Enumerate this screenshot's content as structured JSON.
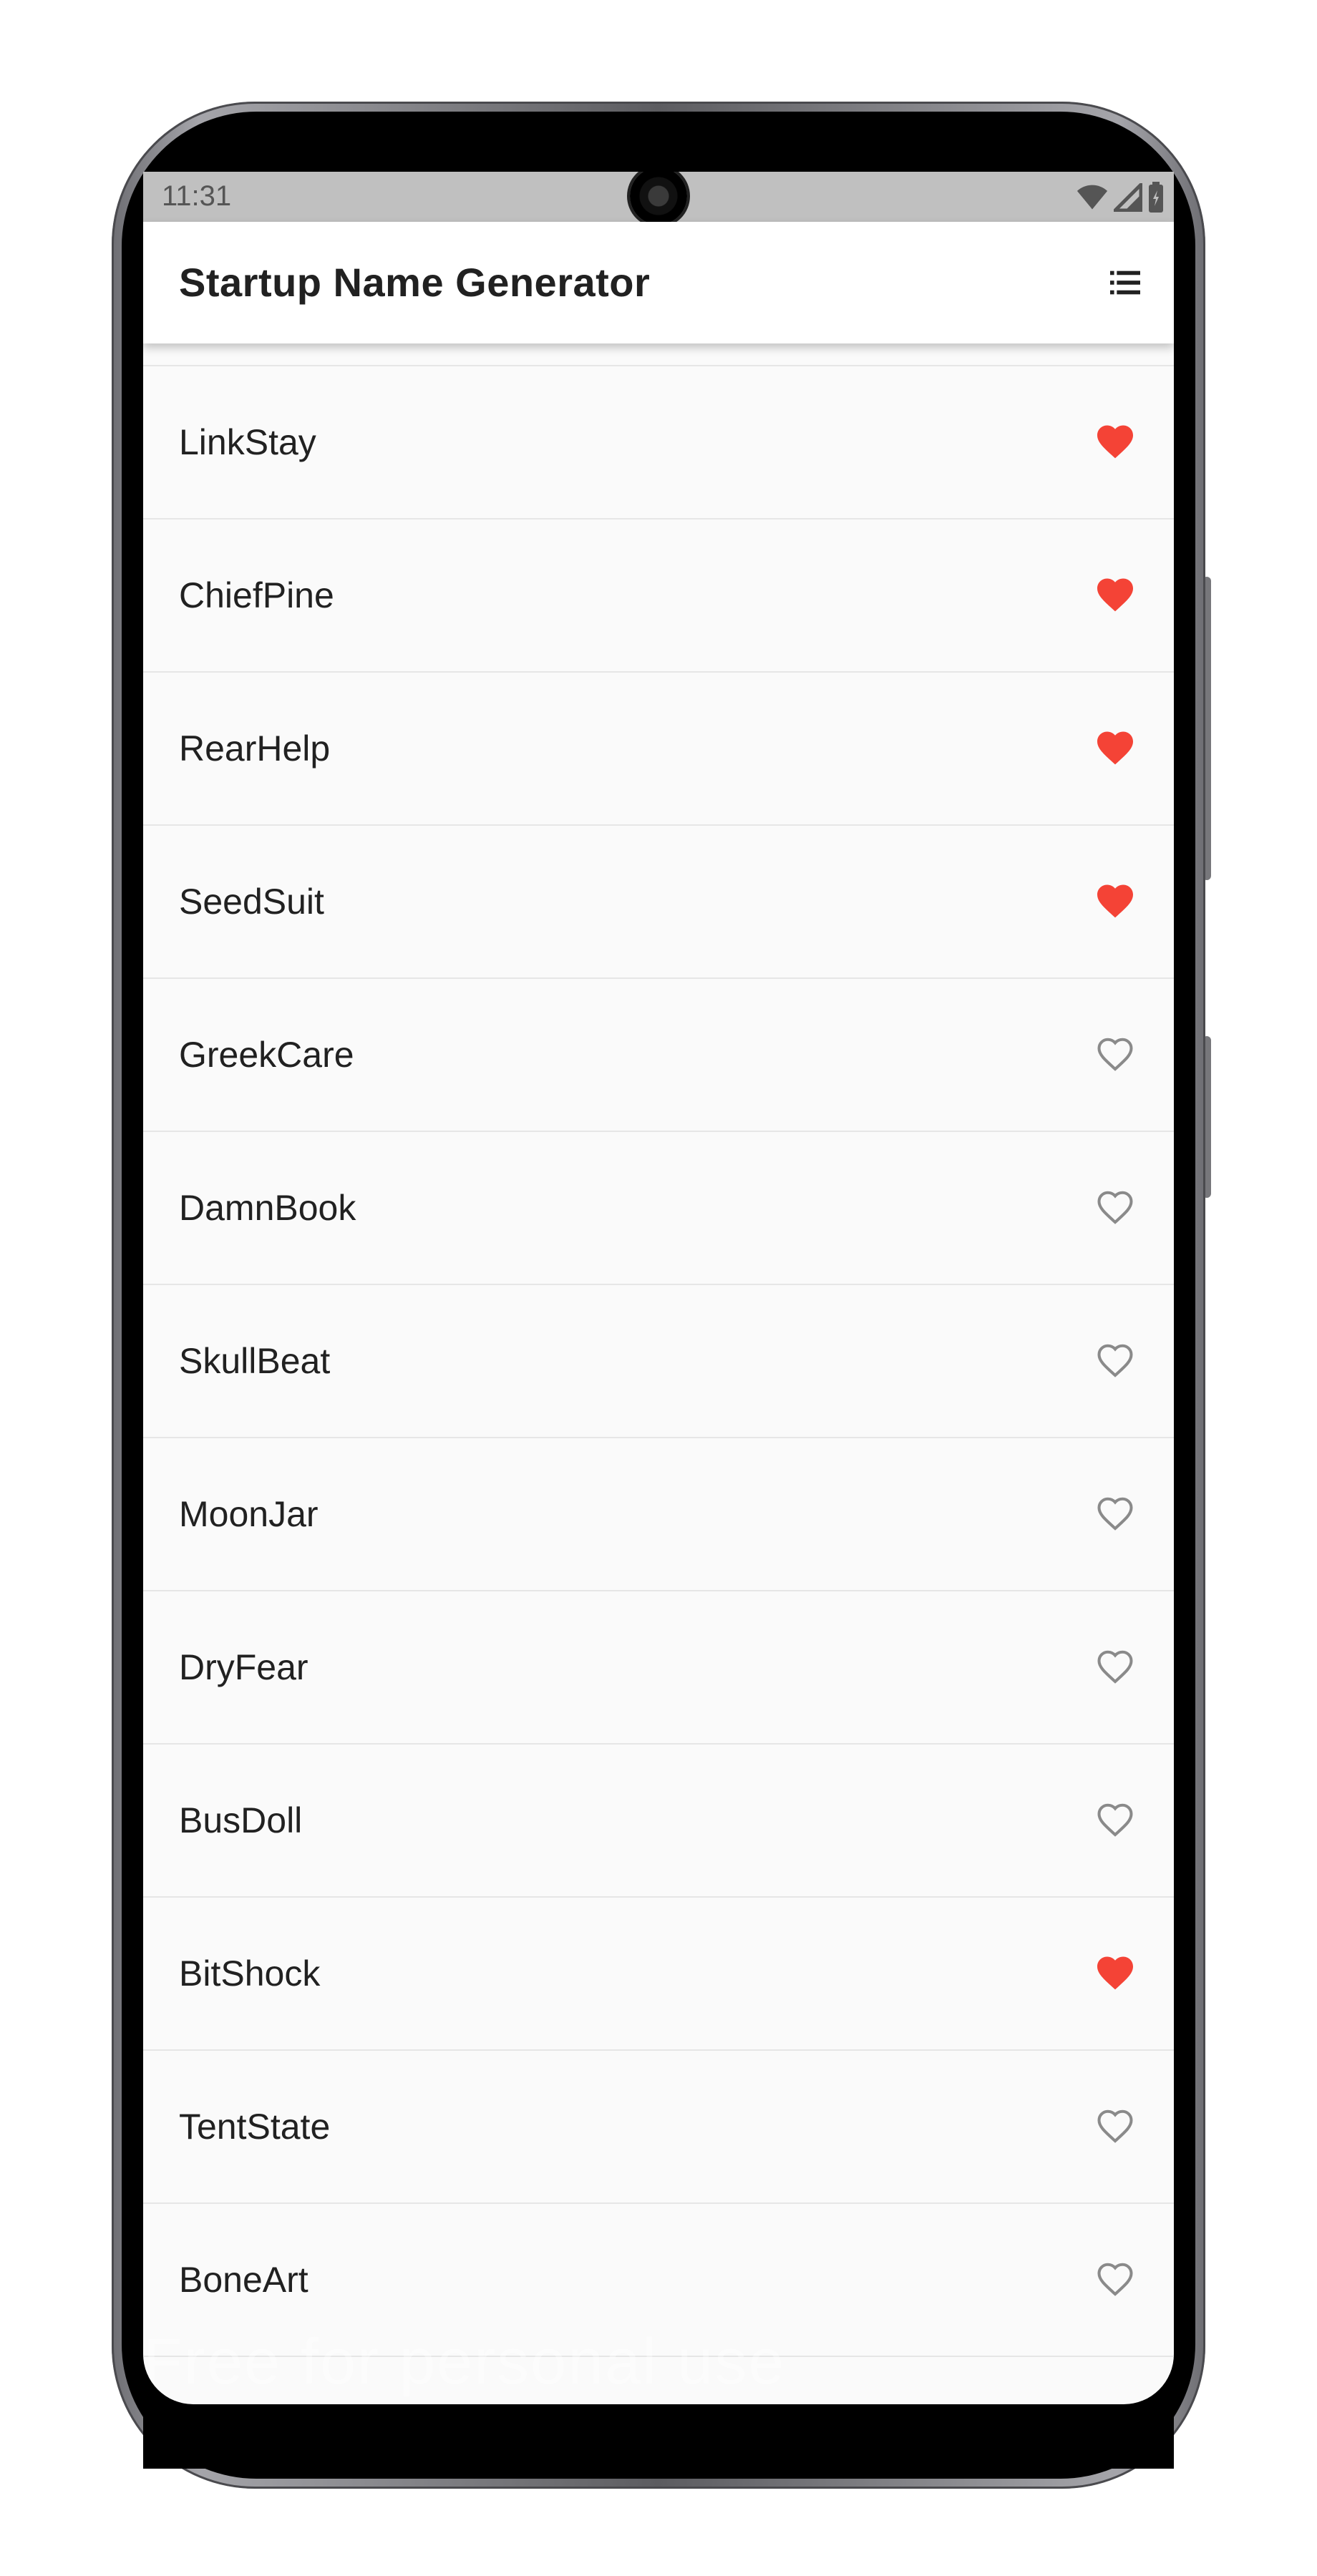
{
  "status_bar": {
    "time": "11:31",
    "icons": [
      "wifi-icon",
      "signal-icon",
      "battery-icon"
    ]
  },
  "app_bar": {
    "title": "Startup Name Generator",
    "action_icon": "list-icon"
  },
  "names": [
    {
      "label": "LinkStay",
      "saved": true
    },
    {
      "label": "ChiefPine",
      "saved": true
    },
    {
      "label": "RearHelp",
      "saved": true
    },
    {
      "label": "SeedSuit",
      "saved": true
    },
    {
      "label": "GreekCare",
      "saved": false
    },
    {
      "label": "DamnBook",
      "saved": false
    },
    {
      "label": "SkullBeat",
      "saved": false
    },
    {
      "label": "MoonJar",
      "saved": false
    },
    {
      "label": "DryFear",
      "saved": false
    },
    {
      "label": "BusDoll",
      "saved": false
    },
    {
      "label": "BitShock",
      "saved": true
    },
    {
      "label": "TentState",
      "saved": false
    },
    {
      "label": "BoneArt",
      "saved": false
    }
  ],
  "watermark": "Free for personal use",
  "colors": {
    "saved_heart": "#f44336",
    "unsaved_heart": "#8a8a8a",
    "app_bar": "#ffffff",
    "status_bar": "#c0c0c0",
    "list_background": "#fafafa"
  }
}
